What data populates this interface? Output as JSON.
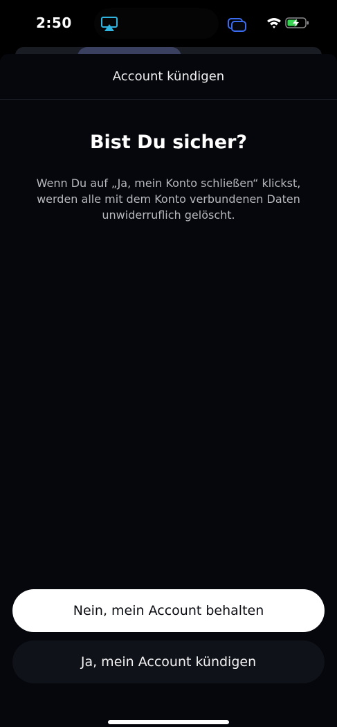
{
  "status_bar": {
    "time": "2:50",
    "icons": [
      "airplay-icon",
      "screen-mirror-icon",
      "wifi-icon",
      "battery-charging-icon"
    ],
    "colors": {
      "airplay": "#2fb5e0",
      "screen_mirror": "#3a6cf0",
      "battery_fill": "#39d353"
    }
  },
  "sheet": {
    "title": "Account kündigen",
    "heading": "Bist Du sicher?",
    "body": "Wenn Du auf „Ja, mein Konto schließen“ klickst, werden alle mit dem Konto verbundenen Daten unwiderruflich gelöscht."
  },
  "buttons": {
    "keep_label": "Nein, mein Account behalten",
    "cancel_label": "Ja, mein Account kündigen"
  }
}
